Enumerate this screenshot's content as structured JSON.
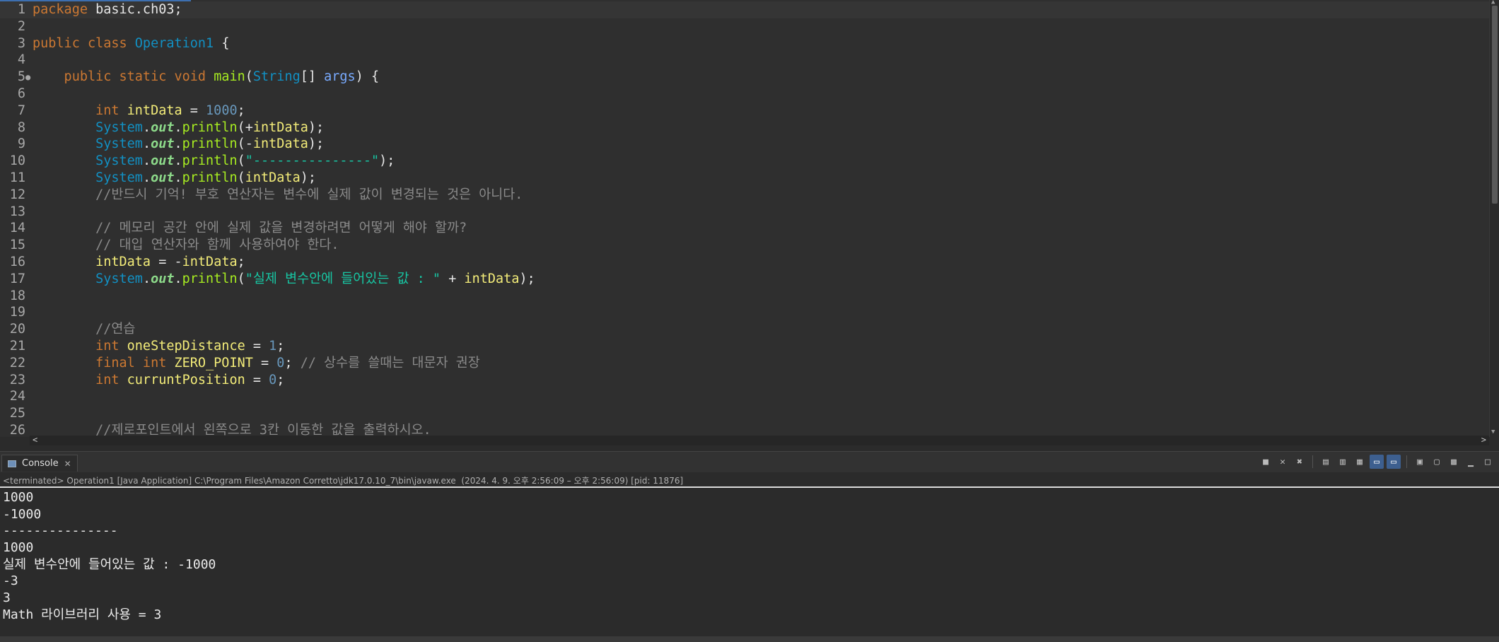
{
  "editor": {
    "lines": [
      {
        "n": "1",
        "tokens": [
          {
            "t": "package ",
            "c": "kw"
          },
          {
            "t": "basic.ch03;",
            "c": "sym"
          }
        ]
      },
      {
        "n": "2",
        "tokens": []
      },
      {
        "n": "3",
        "tokens": [
          {
            "t": "public class ",
            "c": "kw"
          },
          {
            "t": "Operation1",
            "c": "ty"
          },
          {
            "t": " {",
            "c": "sym"
          }
        ]
      },
      {
        "n": "4",
        "tokens": []
      },
      {
        "n": "5",
        "mark": "●",
        "tokens": [
          {
            "t": "    public static void ",
            "c": "kw"
          },
          {
            "t": "main",
            "c": "fn"
          },
          {
            "t": "(",
            "c": "sym"
          },
          {
            "t": "String",
            "c": "ty"
          },
          {
            "t": "[] ",
            "c": "sym"
          },
          {
            "t": "args",
            "c": "par"
          },
          {
            "t": ") {",
            "c": "sym"
          }
        ]
      },
      {
        "n": "6",
        "tokens": []
      },
      {
        "n": "7",
        "tokens": [
          {
            "t": "        int ",
            "c": "kw"
          },
          {
            "t": "intData",
            "c": "var"
          },
          {
            "t": " = ",
            "c": "sym"
          },
          {
            "t": "1000",
            "c": "num"
          },
          {
            "t": ";",
            "c": "sym"
          }
        ]
      },
      {
        "n": "8",
        "tokens": [
          {
            "t": "        System",
            "c": "ty"
          },
          {
            "t": ".",
            "c": "sym"
          },
          {
            "t": "out",
            "c": "out"
          },
          {
            "t": ".",
            "c": "sym"
          },
          {
            "t": "println",
            "c": "fn"
          },
          {
            "t": "(+",
            "c": "sym"
          },
          {
            "t": "intData",
            "c": "var"
          },
          {
            "t": ");",
            "c": "sym"
          }
        ]
      },
      {
        "n": "9",
        "tokens": [
          {
            "t": "        System",
            "c": "ty"
          },
          {
            "t": ".",
            "c": "sym"
          },
          {
            "t": "out",
            "c": "out"
          },
          {
            "t": ".",
            "c": "sym"
          },
          {
            "t": "println",
            "c": "fn"
          },
          {
            "t": "(-",
            "c": "sym"
          },
          {
            "t": "intData",
            "c": "var"
          },
          {
            "t": ");",
            "c": "sym"
          }
        ]
      },
      {
        "n": "10",
        "tokens": [
          {
            "t": "        System",
            "c": "ty"
          },
          {
            "t": ".",
            "c": "sym"
          },
          {
            "t": "out",
            "c": "out"
          },
          {
            "t": ".",
            "c": "sym"
          },
          {
            "t": "println",
            "c": "fn"
          },
          {
            "t": "(",
            "c": "sym"
          },
          {
            "t": "\"---------------\"",
            "c": "str"
          },
          {
            "t": ");",
            "c": "sym"
          }
        ]
      },
      {
        "n": "11",
        "tokens": [
          {
            "t": "        System",
            "c": "ty"
          },
          {
            "t": ".",
            "c": "sym"
          },
          {
            "t": "out",
            "c": "out"
          },
          {
            "t": ".",
            "c": "sym"
          },
          {
            "t": "println",
            "c": "fn"
          },
          {
            "t": "(",
            "c": "sym"
          },
          {
            "t": "intData",
            "c": "var"
          },
          {
            "t": ");",
            "c": "sym"
          }
        ]
      },
      {
        "n": "12",
        "tokens": [
          {
            "t": "        //반드시 기억! 부호 연산자는 변수에 실제 값이 변경되는 것은 아니다.",
            "c": "cm"
          }
        ]
      },
      {
        "n": "13",
        "tokens": []
      },
      {
        "n": "14",
        "tokens": [
          {
            "t": "        // 메모리 공간 안에 실제 값을 변경하려면 어떻게 해야 할까?",
            "c": "cm"
          }
        ]
      },
      {
        "n": "15",
        "tokens": [
          {
            "t": "        // 대입 연산자와 함께 사용하여야 한다.",
            "c": "cm"
          }
        ]
      },
      {
        "n": "16",
        "tokens": [
          {
            "t": "        intData",
            "c": "var"
          },
          {
            "t": " = -",
            "c": "sym"
          },
          {
            "t": "intData",
            "c": "var"
          },
          {
            "t": ";",
            "c": "sym"
          }
        ]
      },
      {
        "n": "17",
        "tokens": [
          {
            "t": "        System",
            "c": "ty"
          },
          {
            "t": ".",
            "c": "sym"
          },
          {
            "t": "out",
            "c": "out"
          },
          {
            "t": ".",
            "c": "sym"
          },
          {
            "t": "println",
            "c": "fn"
          },
          {
            "t": "(",
            "c": "sym"
          },
          {
            "t": "\"실제 변수안에 들어있는 값 : \"",
            "c": "str"
          },
          {
            "t": " + ",
            "c": "sym"
          },
          {
            "t": "intData",
            "c": "var"
          },
          {
            "t": ");",
            "c": "sym"
          }
        ]
      },
      {
        "n": "18",
        "tokens": []
      },
      {
        "n": "19",
        "tokens": []
      },
      {
        "n": "20",
        "tokens": [
          {
            "t": "        //연습",
            "c": "cm"
          }
        ]
      },
      {
        "n": "21",
        "tokens": [
          {
            "t": "        int ",
            "c": "kw"
          },
          {
            "t": "oneStepDistance",
            "c": "var"
          },
          {
            "t": " = ",
            "c": "sym"
          },
          {
            "t": "1",
            "c": "num"
          },
          {
            "t": ";",
            "c": "sym"
          }
        ]
      },
      {
        "n": "22",
        "tokens": [
          {
            "t": "        final int ",
            "c": "kw"
          },
          {
            "t": "ZERO_POINT",
            "c": "var"
          },
          {
            "t": " = ",
            "c": "sym"
          },
          {
            "t": "0",
            "c": "num"
          },
          {
            "t": "; ",
            "c": "sym"
          },
          {
            "t": "// 상수를 쓸때는 대문자 권장",
            "c": "cm"
          }
        ]
      },
      {
        "n": "23",
        "tokens": [
          {
            "t": "        int ",
            "c": "kw"
          },
          {
            "t": "curruntPosition",
            "c": "var"
          },
          {
            "t": " = ",
            "c": "sym"
          },
          {
            "t": "0",
            "c": "num"
          },
          {
            "t": ";",
            "c": "sym"
          }
        ]
      },
      {
        "n": "24",
        "tokens": []
      },
      {
        "n": "25",
        "tokens": []
      },
      {
        "n": "26",
        "tokens": [
          {
            "t": "        //제로포인트에서 왼쪽으로 3칸 이동한 값을 출력하시오.",
            "c": "cm"
          }
        ]
      }
    ]
  },
  "console": {
    "tab_label": "Console",
    "status": "<terminated> Operation1 [Java Application] C:\\Program Files\\Amazon Corretto\\jdk17.0.10_7\\bin\\javaw.exe  (2024. 4. 9. 오후 2:56:09 – 오후 2:56:09) [pid: 11876]",
    "output": [
      "1000",
      "-1000",
      "---------------",
      "1000",
      "실제 변수안에 들어있는 값 : -1000",
      "-3",
      "3",
      "Math 라이브러리 사용 = 3"
    ]
  },
  "icons": {
    "close": "✕",
    "mark": "●",
    "scroll_left": "<",
    "scroll_right": ">",
    "scroll_up": "▲",
    "scroll_down": "▼"
  }
}
